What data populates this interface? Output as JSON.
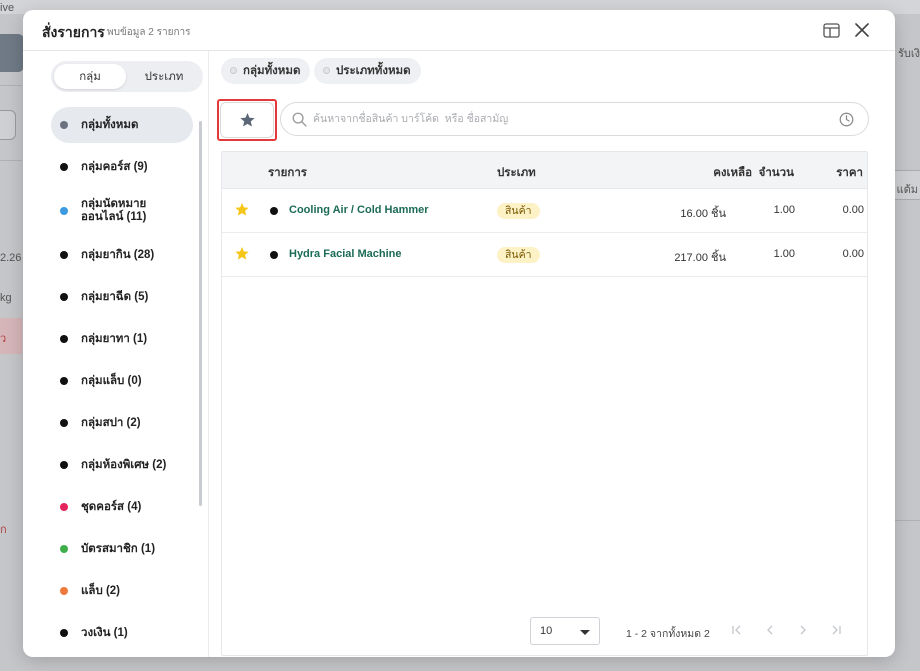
{
  "background": {
    "top_left_text": "ive",
    "left_texts": [
      "2.26",
      "kg",
      "ว",
      "ก"
    ],
    "right_texts": [
      "รับเงิ",
      "แต้ม"
    ]
  },
  "modal": {
    "title": "สั่งรายการ",
    "subtitle": "พบข้อมูล 2 รายการ",
    "icons": {
      "layout": "layout-icon",
      "close": "close-icon"
    }
  },
  "sidebar": {
    "segments": [
      {
        "label": "กลุ่ม",
        "active": true
      },
      {
        "label": "ประเภท",
        "active": false
      }
    ],
    "categories": [
      {
        "label": "กลุ่มทั้งหมด",
        "color": "#6b7280",
        "active": true
      },
      {
        "label": "กลุ่มคอร์ส (9)",
        "color": "#111111"
      },
      {
        "label": "กลุ่มนัดหมายออนไลน์ (11)",
        "label_line1": "กลุ่มนัดหมาย",
        "label_line2": "ออนไลน์ (11)",
        "color": "#3b9ae1"
      },
      {
        "label": "กลุ่มยากิน (28)",
        "color": "#111111"
      },
      {
        "label": "กลุ่มยาฉีด (5)",
        "color": "#111111"
      },
      {
        "label": "กลุ่มยาทา (1)",
        "color": "#111111"
      },
      {
        "label": "กลุ่มแล็บ (0)",
        "color": "#111111"
      },
      {
        "label": "กลุ่มสปา (2)",
        "color": "#111111"
      },
      {
        "label": "กลุ่มห้องพิเศษ (2)",
        "color": "#111111"
      },
      {
        "label": "ชุดคอร์ส (4)",
        "color": "#e5245e"
      },
      {
        "label": "บัตรสมาชิก (1)",
        "color": "#3db04b"
      },
      {
        "label": "แล็บ (2)",
        "color": "#f07a3c"
      },
      {
        "label": "วงเงิน (1)",
        "color": "#111111"
      }
    ]
  },
  "filters": {
    "chips": [
      "กลุ่มทั้งหมด",
      "ประเภททั้งหมด"
    ],
    "search_placeholder": "ค้นหาจากชื่อสินค้า บาร์โค้ด  หรือ ชื่อสามัญ",
    "search_value": ""
  },
  "table": {
    "headers": {
      "item": "รายการ",
      "type": "ประเภท",
      "remaining": "คงเหลือ",
      "quantity": "จำนวน",
      "price": "ราคา"
    },
    "rows": [
      {
        "favorite": true,
        "name": "Cooling Air / Cold Hammer",
        "type": "สินค้า",
        "remaining": "16.00 ชิ้น",
        "quantity": "1.00",
        "price": "0.00"
      },
      {
        "favorite": true,
        "name": "Hydra Facial Machine",
        "type": "สินค้า",
        "remaining": "217.00 ชิ้น",
        "quantity": "1.00",
        "price": "0.00"
      }
    ]
  },
  "pagination": {
    "page_size": "10",
    "info": "1 - 2 จากทั้งหมด 2"
  },
  "colors": {
    "accent_green": "#1b6b56",
    "star_yellow": "#f5c518",
    "highlight_red": "#e23a3a",
    "badge_bg": "#fdf1c6"
  }
}
